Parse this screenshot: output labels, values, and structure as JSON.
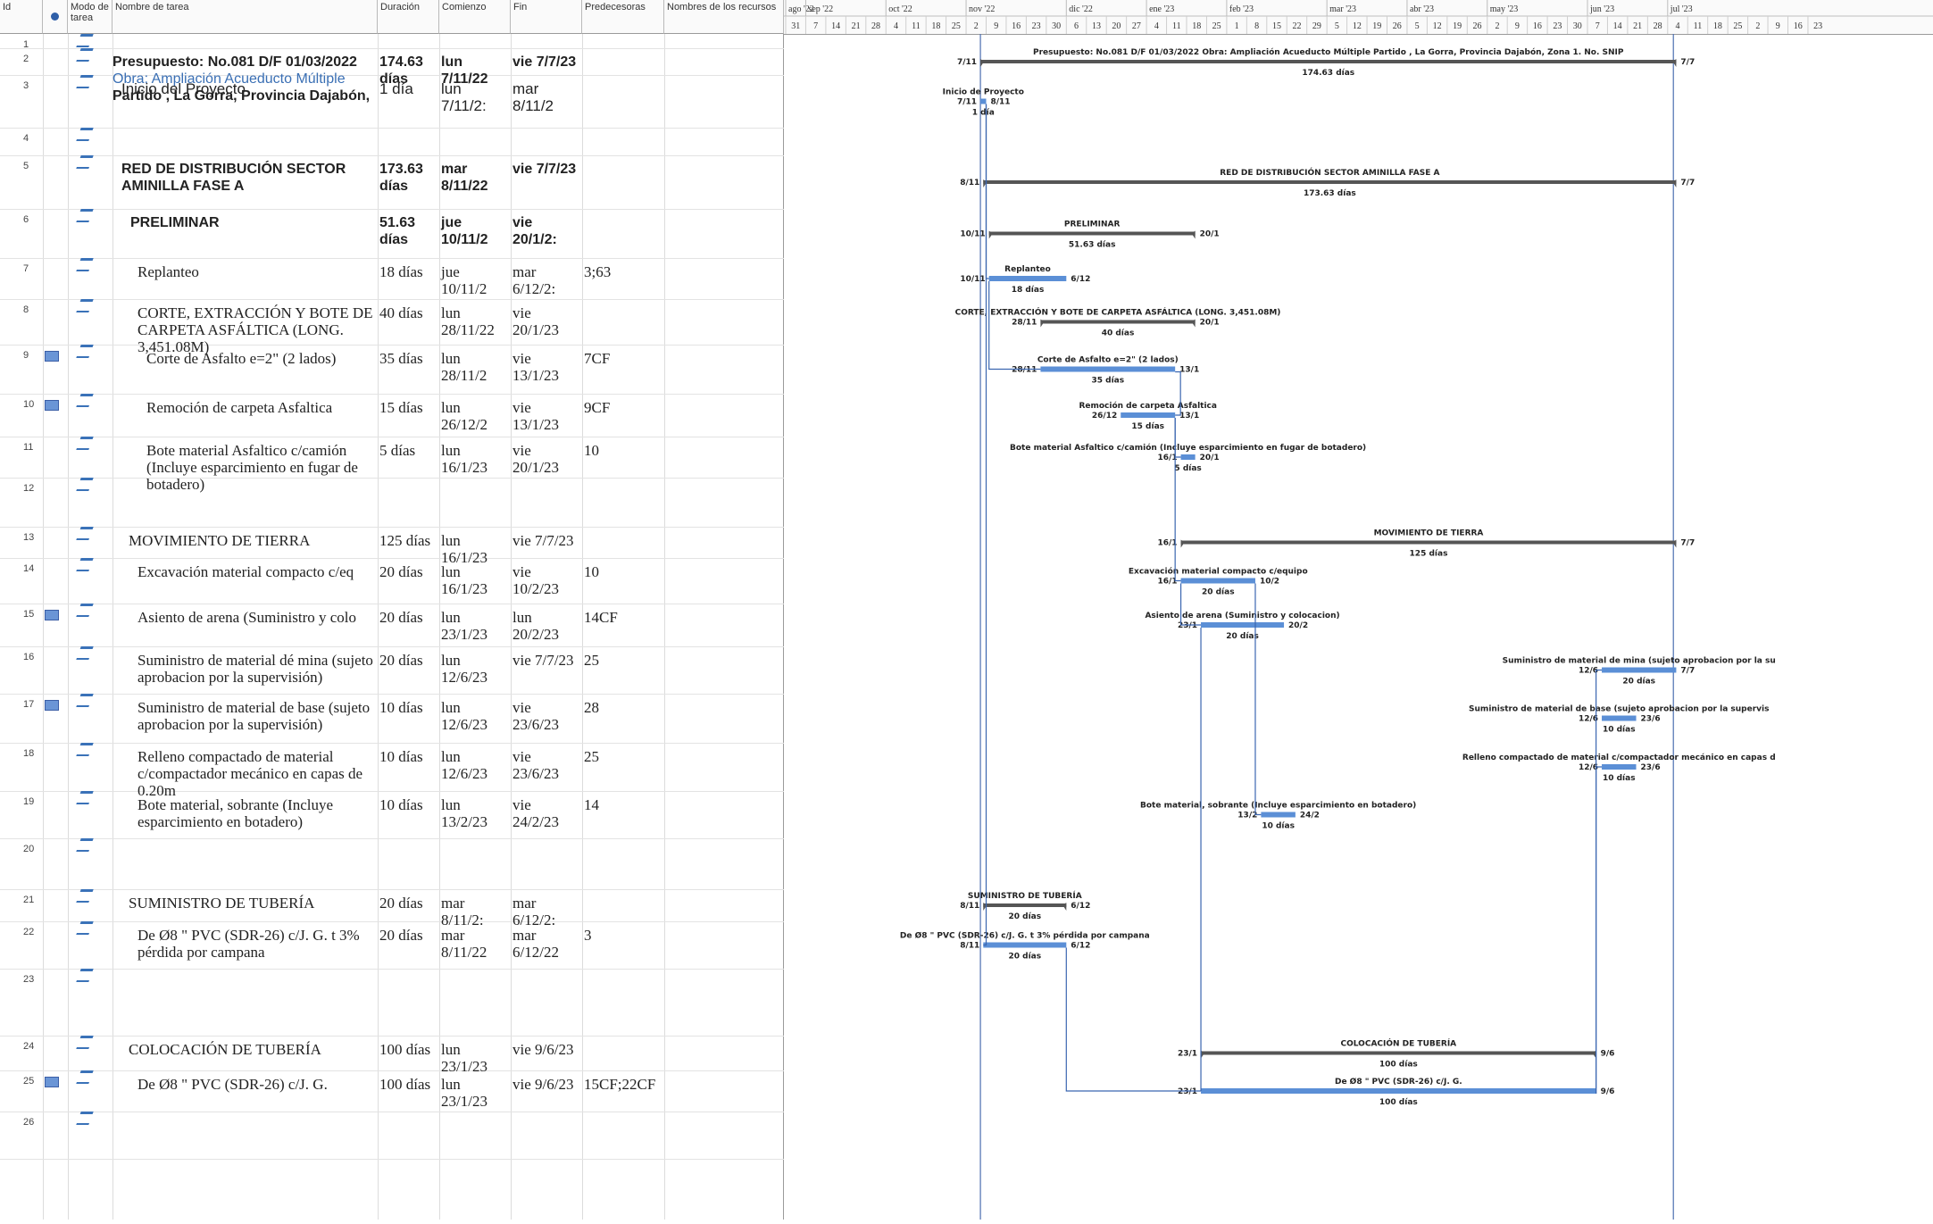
{
  "columns": {
    "id": "Id",
    "indicator": "",
    "mode": "Modo de tarea",
    "name": "Nombre de tarea",
    "duration": "Duración",
    "start": "Comienzo",
    "finish": "Fin",
    "predecessors": "Predecesoras",
    "resources": "Nombres de los recursos"
  },
  "timescale": {
    "months": [
      "ago '22",
      "sep '22",
      "oct '22",
      "nov '22",
      "dic '22",
      "ene '23",
      "feb '23",
      "mar '23",
      "abr '23",
      "may '23",
      "jun '23",
      "jul '23"
    ],
    "days": [
      "31",
      "7",
      "14",
      "21",
      "28",
      "4",
      "11",
      "18",
      "25",
      "2",
      "9",
      "16",
      "23",
      "30",
      "6",
      "13",
      "20",
      "27",
      "4",
      "11",
      "18",
      "25",
      "1",
      "8",
      "15",
      "22",
      "29",
      "5",
      "12",
      "19",
      "26",
      "5",
      "12",
      "19",
      "26",
      "2",
      "9",
      "16",
      "23",
      "30",
      "7",
      "14",
      "21",
      "28",
      "4",
      "11",
      "18",
      "25",
      "2",
      "9",
      "16",
      "23"
    ]
  },
  "rows": [
    {
      "id": "1",
      "name": "",
      "duration": "",
      "start": "",
      "finish": "",
      "pred": "",
      "indicator": false,
      "bold": false
    },
    {
      "id": "2",
      "name": "Presupuesto: No.081 D/F 01/03/2022",
      "name_line2": "Obra: Ampliación Acueducto Múltiple",
      "name_line3": "Partido , La Gorra, Provincia Dajabón,",
      "duration": "174.63 días",
      "start": "lun 7/11/22",
      "finish": "vie 7/7/23",
      "pred": "",
      "indicator": false,
      "bold": true
    },
    {
      "id": "3",
      "name": "Inicio del Proyecto",
      "duration": "1 día",
      "start": "lun 7/11/2:",
      "finish": "mar 8/11/2",
      "pred": "",
      "indicator": false,
      "bold": false,
      "sans": true
    },
    {
      "id": "4",
      "name": "",
      "duration": "",
      "start": "",
      "finish": "",
      "pred": "",
      "indicator": false,
      "bold": false
    },
    {
      "id": "5",
      "name": "RED DE DISTRIBUCIÓN SECTOR AMINILLA FASE A",
      "duration": "173.63 días",
      "start": "mar 8/11/22",
      "finish": "vie 7/7/23",
      "pred": "",
      "indicator": false,
      "bold": true
    },
    {
      "id": "6",
      "name": "PRELIMINAR",
      "duration": "51.63 días",
      "start": "jue 10/11/2",
      "finish": "vie 20/1/2:",
      "pred": "",
      "indicator": false,
      "bold": true
    },
    {
      "id": "7",
      "name": "Replanteo",
      "duration": "18 días",
      "start": "jue 10/11/2",
      "finish": "mar 6/12/2:",
      "pred": "3;63",
      "indicator": false,
      "bold": false
    },
    {
      "id": "8",
      "name": "CORTE, EXTRACCIÓN Y BOTE DE CARPETA ASFÁLTICA (LONG. 3,451.08M)",
      "duration": "40 días",
      "start": "lun 28/11/22",
      "finish": "vie 20/1/23",
      "pred": "",
      "indicator": false,
      "bold": false
    },
    {
      "id": "9",
      "name": "Corte de Asfalto e=2\" (2 lados)",
      "duration": "35 días",
      "start": "lun 28/11/2",
      "finish": "vie 13/1/23",
      "pred": "7CF",
      "indicator": true,
      "bold": false
    },
    {
      "id": "10",
      "name": "Remoción de carpeta Asfaltica",
      "duration": "15 días",
      "start": "lun 26/12/2",
      "finish": "vie 13/1/23",
      "pred": "9CF",
      "indicator": true,
      "bold": false
    },
    {
      "id": "11",
      "name": "Bote material Asfaltico c/camión (Incluye esparcimiento en fugar de botadero)",
      "duration": "5 días",
      "start": "lun 16/1/23",
      "finish": "vie 20/1/23",
      "pred": "10",
      "indicator": false,
      "bold": false
    },
    {
      "id": "12",
      "name": "",
      "duration": "",
      "start": "",
      "finish": "",
      "pred": "",
      "indicator": false,
      "bold": false
    },
    {
      "id": "13",
      "name": "MOVIMIENTO DE TIERRA",
      "duration": "125 días",
      "start": "lun 16/1/23",
      "finish": "vie 7/7/23",
      "pred": "",
      "indicator": false,
      "bold": false
    },
    {
      "id": "14",
      "name": "Excavación material compacto c/eq",
      "duration": "20 días",
      "start": "lun 16/1/23",
      "finish": "vie 10/2/23",
      "pred": "10",
      "indicator": false,
      "bold": false
    },
    {
      "id": "15",
      "name": "Asiento de arena (Suministro y colo",
      "duration": "20 días",
      "start": "lun 23/1/23",
      "finish": "lun 20/2/23",
      "pred": "14CF",
      "indicator": true,
      "bold": false
    },
    {
      "id": "16",
      "name": "Suministro de material dé mina (sujeto aprobacion por la supervisión)",
      "duration": "20 días",
      "start": "lun 12/6/23",
      "finish": "vie 7/7/23",
      "pred": "25",
      "indicator": false,
      "bold": false
    },
    {
      "id": "17",
      "name": "Suministro de material de base (sujeto aprobacion por la supervisión)",
      "duration": "10 días",
      "start": "lun 12/6/23",
      "finish": "vie 23/6/23",
      "pred": "28",
      "indicator": true,
      "bold": false
    },
    {
      "id": "18",
      "name": "Relleno compactado de material c/compactador mecánico en capas de 0.20m",
      "duration": "10 días",
      "start": "lun 12/6/23",
      "finish": "vie 23/6/23",
      "pred": "25",
      "indicator": false,
      "bold": false
    },
    {
      "id": "19",
      "name": "Bote material, sobrante (Incluye esparcimiento en botadero)",
      "duration": "10 días",
      "start": "lun 13/2/23",
      "finish": "vie 24/2/23",
      "pred": "14",
      "indicator": false,
      "bold": false
    },
    {
      "id": "20",
      "name": "",
      "duration": "",
      "start": "",
      "finish": "",
      "pred": "",
      "indicator": false,
      "bold": false
    },
    {
      "id": "21",
      "name": "SUMINISTRO DE TUBERÍA",
      "duration": "20 días",
      "start": "mar 8/11/2:",
      "finish": "mar 6/12/2:",
      "pred": "",
      "indicator": false,
      "bold": false
    },
    {
      "id": "22",
      "name": "De Ø8 \" PVC (SDR-26) c/J. G. t 3% pérdida por campana",
      "duration": "20 días",
      "start": "mar 8/11/22",
      "finish": "mar 6/12/22",
      "pred": "3",
      "indicator": false,
      "bold": false
    },
    {
      "id": "23",
      "name": "",
      "duration": "",
      "start": "",
      "finish": "",
      "pred": "",
      "indicator": false,
      "bold": false
    },
    {
      "id": "24",
      "name": "COLOCACIÓN DE TUBERÍA",
      "duration": "100 días",
      "start": "lun 23/1/23",
      "finish": "vie 9/6/23",
      "pred": "",
      "indicator": false,
      "bold": false
    },
    {
      "id": "25",
      "name": "De Ø8 \" PVC (SDR-26) c/J. G.",
      "duration": "100 días",
      "start": "lun 23/1/23",
      "finish": "vie 9/6/23",
      "pred": "15CF;22CF",
      "indicator": true,
      "bold": false
    },
    {
      "id": "26",
      "name": "",
      "duration": "",
      "start": "",
      "finish": "",
      "pred": "",
      "indicator": false,
      "bold": false
    }
  ],
  "gantt": {
    "bars": [
      {
        "row": "2",
        "kind": "summary",
        "start": "2022-11-07",
        "end": "2023-07-07",
        "left": "7/11",
        "right": "7/7",
        "label": "Presupuesto: No.081 D/F 01/03/2022 Obra: Ampliación Acueducto Múltiple Partido , La Gorra, Provincia Dajabón, Zona 1. No. SNIP",
        "duration": "174.63 días"
      },
      {
        "row": "3",
        "kind": "task",
        "start": "2022-11-07",
        "end": "2022-11-08",
        "left": "7/11",
        "right": "8/11",
        "label": "Inicio de Proyecto",
        "duration": "1 día"
      },
      {
        "row": "5",
        "kind": "summary",
        "start": "2022-11-08",
        "end": "2023-07-07",
        "left": "8/11",
        "right": "7/7",
        "label": "RED DE DISTRIBUCIÓN SECTOR AMINILLA FASE A",
        "duration": "173.63 días"
      },
      {
        "row": "6",
        "kind": "summary",
        "start": "2022-11-10",
        "end": "2023-01-20",
        "left": "10/11",
        "right": "20/1",
        "label": "PRELIMINAR",
        "duration": "51.63 días"
      },
      {
        "row": "7",
        "kind": "task",
        "start": "2022-11-10",
        "end": "2022-12-06",
        "left": "10/11",
        "right": "6/12",
        "label": "Replanteo",
        "duration": "18 días"
      },
      {
        "row": "8",
        "kind": "summary",
        "start": "2022-11-28",
        "end": "2023-01-20",
        "left": "28/11",
        "right": "20/1",
        "label": "CORTE, EXTRACCIÓN Y BOTE DE CARPETA ASFÁLTICA (LONG. 3,451.08M)",
        "duration": "40 días"
      },
      {
        "row": "9",
        "kind": "task",
        "start": "2022-11-28",
        "end": "2023-01-13",
        "left": "28/11",
        "right": "13/1",
        "label": "Corte de Asfalto e=2\" (2 lados)",
        "duration": "35 días"
      },
      {
        "row": "10",
        "kind": "task",
        "start": "2022-12-26",
        "end": "2023-01-13",
        "left": "26/12",
        "right": "13/1",
        "label": "Remoción de carpeta Asfaltica",
        "duration": "15 días"
      },
      {
        "row": "11",
        "kind": "task",
        "start": "2023-01-16",
        "end": "2023-01-20",
        "left": "16/1",
        "right": "20/1",
        "label": "Bote material Asfaltico c/camión (Incluye esparcimiento en fugar de botadero)",
        "duration": "5 días"
      },
      {
        "row": "13",
        "kind": "summary",
        "start": "2023-01-16",
        "end": "2023-07-07",
        "left": "16/1",
        "right": "7/7",
        "label": "MOVIMIENTO DE TIERRA",
        "duration": "125 días"
      },
      {
        "row": "14",
        "kind": "task",
        "start": "2023-01-16",
        "end": "2023-02-10",
        "left": "16/1",
        "right": "10/2",
        "label": "Excavación material compacto c/equipo",
        "duration": "20 días"
      },
      {
        "row": "15",
        "kind": "task",
        "start": "2023-01-23",
        "end": "2023-02-20",
        "left": "23/1",
        "right": "20/2",
        "label": "Asiento de arena (Suministro y colocacion)",
        "duration": "20 días"
      },
      {
        "row": "16",
        "kind": "task",
        "start": "2023-06-12",
        "end": "2023-07-07",
        "left": "12/6",
        "right": "7/7",
        "label": "Suministro de material de mina (sujeto aprobacion por la su",
        "duration": "20 días"
      },
      {
        "row": "17",
        "kind": "task",
        "start": "2023-06-12",
        "end": "2023-06-23",
        "left": "12/6",
        "right": "23/6",
        "label": "Suministro de material de base (sujeto aprobacion por la supervis",
        "duration": "10 días"
      },
      {
        "row": "18",
        "kind": "task",
        "start": "2023-06-12",
        "end": "2023-06-23",
        "left": "12/6",
        "right": "23/6",
        "label": "Relleno compactado de material c/compactador mecánico en capas d",
        "duration": "10 días"
      },
      {
        "row": "19",
        "kind": "task",
        "start": "2023-02-13",
        "end": "2023-02-24",
        "left": "13/2",
        "right": "24/2",
        "label": "Bote material, sobrante (Incluye esparcimiento en botadero)",
        "duration": "10 días"
      },
      {
        "row": "21",
        "kind": "summary",
        "start": "2022-11-08",
        "end": "2022-12-06",
        "left": "8/11",
        "right": "6/12",
        "label": "SUMINISTRO DE TUBERÍA",
        "duration": "20 días"
      },
      {
        "row": "22",
        "kind": "task",
        "start": "2022-11-08",
        "end": "2022-12-06",
        "left": "8/11",
        "right": "6/12",
        "label": "De Ø8 \" PVC (SDR-26) c/J. G. t 3% pérdida por campana",
        "duration": "20 días"
      },
      {
        "row": "24",
        "kind": "summary",
        "start": "2023-01-23",
        "end": "2023-06-09",
        "left": "23/1",
        "right": "9/6",
        "label": "COLOCACIÓN DE TUBERÍA",
        "duration": "100 días"
      },
      {
        "row": "25",
        "kind": "task",
        "start": "2023-01-23",
        "end": "2023-06-09",
        "left": "23/1",
        "right": "9/6",
        "label": "De Ø8 \" PVC (SDR-26) c/J. G.",
        "duration": "100 días"
      }
    ],
    "colors": {
      "task": "#5b8fd6",
      "summary": "#555555",
      "link": "#3b66b0",
      "text": "#222222"
    }
  }
}
